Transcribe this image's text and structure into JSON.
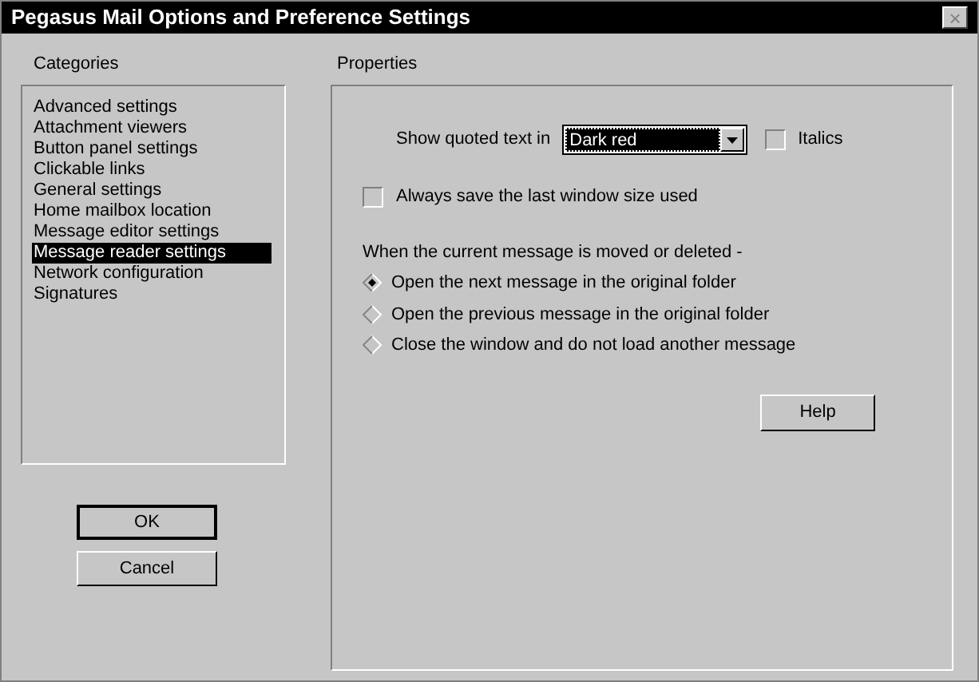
{
  "window": {
    "title": "Pegasus Mail Options and Preference Settings",
    "close": "×"
  },
  "categories": {
    "label": "Categories",
    "items": [
      {
        "label": "Advanced settings",
        "selected": false
      },
      {
        "label": "Attachment viewers",
        "selected": false
      },
      {
        "label": "Button panel settings",
        "selected": false
      },
      {
        "label": "Clickable links",
        "selected": false
      },
      {
        "label": "General settings",
        "selected": false
      },
      {
        "label": "Home mailbox location",
        "selected": false
      },
      {
        "label": "Message editor settings",
        "selected": false
      },
      {
        "label": "Message reader settings",
        "selected": true
      },
      {
        "label": "Network configuration",
        "selected": false
      },
      {
        "label": "Signatures",
        "selected": false
      }
    ]
  },
  "buttons": [
    {
      "label": "OK",
      "default": true
    },
    {
      "label": "Cancel",
      "default": false
    }
  ],
  "properties": {
    "label": "Properties",
    "quoted_text": {
      "label": "Show quoted text in",
      "value": "Dark red"
    },
    "italics": {
      "label": "Italics",
      "checked": false
    },
    "save_size": {
      "label": "Always save the last window size used",
      "checked": false
    },
    "move_group": {
      "label": "When the current message is moved or deleted -",
      "options": [
        {
          "label": "Open the next message in the original folder",
          "selected": true
        },
        {
          "label": "Open the previous message in the original folder",
          "selected": false
        },
        {
          "label": "Close the window and do not load another message",
          "selected": false
        }
      ]
    },
    "help": "Help"
  }
}
